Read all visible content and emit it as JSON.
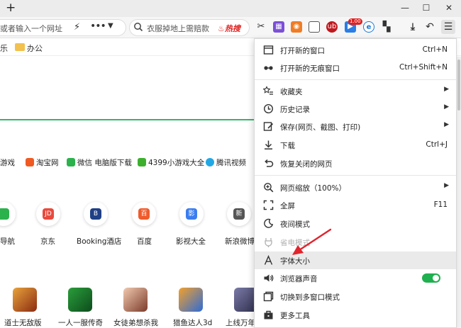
{
  "titlebar": {
    "new_tab": "+",
    "minimize": "—",
    "maximize": "☐",
    "close": "✕"
  },
  "toolbar": {
    "address_placeholder": "或者输入一个网址",
    "search_placeholder": "衣服掉地上需赔款",
    "hot_label": "热搜",
    "badge_count": "1.00"
  },
  "bookmarks": [
    {
      "label": "乐"
    },
    {
      "label": "办公"
    }
  ],
  "links": [
    {
      "label": "游戏"
    },
    {
      "label": "淘宝网"
    },
    {
      "label": "微信 电脑版下载"
    },
    {
      "label": "4399小游戏大全"
    },
    {
      "label": "腾讯视频"
    }
  ],
  "sites": [
    {
      "label": "导航",
      "icon": ""
    },
    {
      "label": "京东",
      "icon": "JD"
    },
    {
      "label": "Booking酒店",
      "icon": "B"
    },
    {
      "label": "百度",
      "icon": "百"
    },
    {
      "label": "影视大全",
      "icon": "影"
    },
    {
      "label": "新浪微博",
      "icon": "新"
    }
  ],
  "games": [
    {
      "label": "道士无敌版"
    },
    {
      "label": "一人一服传奇"
    },
    {
      "label": "女徒弟想杀我"
    },
    {
      "label": "猎鱼达人3d"
    },
    {
      "label": "上线万年"
    }
  ],
  "menu": {
    "items": [
      {
        "label": "打开新的窗口",
        "shortcut": "Ctrl+N"
      },
      {
        "label": "打开新的无痕窗口",
        "shortcut": "Ctrl+Shift+N"
      },
      {
        "label": "收藏夹",
        "arrow": "▶"
      },
      {
        "label": "历史记录",
        "arrow": "▶"
      },
      {
        "label": "保存(网页、截图、打印)",
        "arrow": "▶"
      },
      {
        "label": "下载",
        "shortcut": "Ctrl+J"
      },
      {
        "label": "恢复关闭的网页"
      },
      {
        "label": "网页缩放（100%）",
        "arrow": "▶"
      },
      {
        "label": "全屏",
        "shortcut": "F11"
      },
      {
        "label": "夜间模式"
      },
      {
        "label": "省电模式"
      },
      {
        "label": "字体大小"
      },
      {
        "label": "浏览器声音",
        "toggle_on": true
      },
      {
        "label": "切换到多窗口模式"
      },
      {
        "label": "更多工具"
      }
    ]
  },
  "colors": {
    "accent_green": "#1fb04f",
    "highlight": "#eaeaea",
    "annotation_arrow": "#e0242e"
  }
}
